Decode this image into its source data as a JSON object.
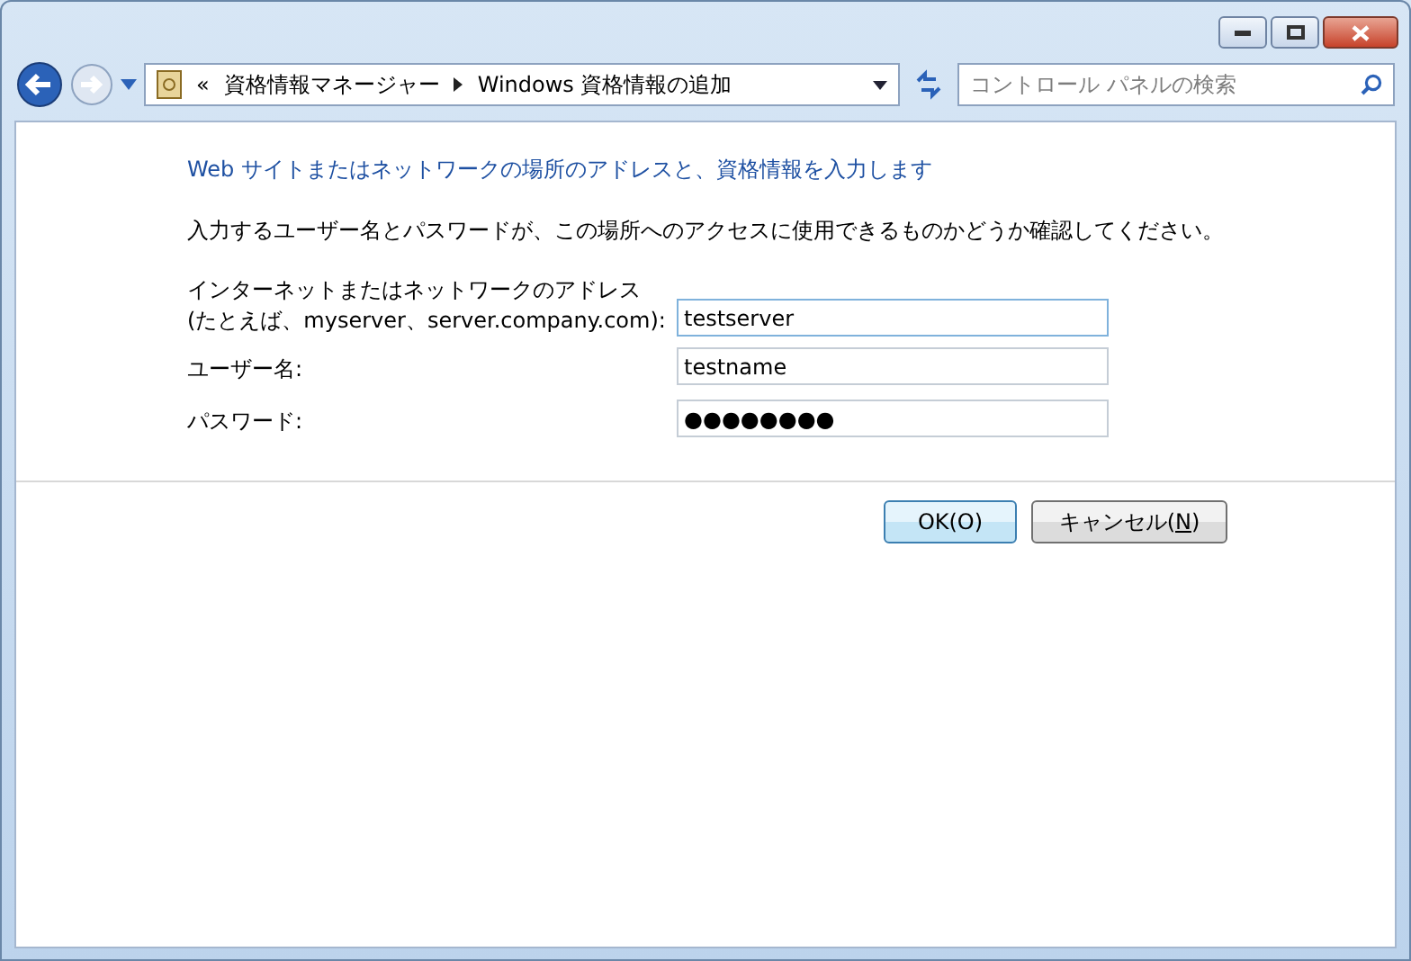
{
  "address_bar": {
    "overflow": "«",
    "crumbs": [
      {
        "label": "資格情報マネージャー"
      },
      {
        "label": "Windows 資格情報の追加"
      }
    ]
  },
  "search": {
    "placeholder": "コントロール パネルの検索"
  },
  "heading": "Web サイトまたはネットワークの場所のアドレスと、資格情報を入力します",
  "instruction": "入力するユーザー名とパスワードが、この場所へのアクセスに使用できるものかどうか確認してください。",
  "fields": [
    {
      "label_lines": [
        "インターネットまたはネットワークのアドレス",
        "(たとえば、myserver、server.company.com):"
      ],
      "value": "testserver",
      "focused": true
    },
    {
      "label_lines": [
        "ユーザー名:"
      ],
      "value": "testname",
      "focused": false
    },
    {
      "label_lines": [
        "パスワード:"
      ],
      "value": "●●●●●●●●",
      "focused": false
    }
  ],
  "buttons": [
    {
      "label": "OK(O)",
      "default": true
    },
    {
      "label_before": "キャンセル(",
      "access_key": "N",
      "label_after": ")",
      "default": false
    }
  ]
}
